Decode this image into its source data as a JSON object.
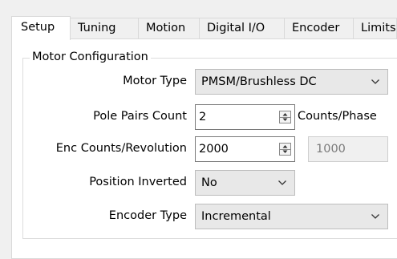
{
  "tabs": [
    {
      "label": "Setup"
    },
    {
      "label": "Tuning"
    },
    {
      "label": "Motion"
    },
    {
      "label": "Digital I/O"
    },
    {
      "label": "Encoder"
    },
    {
      "label": "Limits"
    }
  ],
  "group": {
    "title": "Motor Configuration"
  },
  "fields": {
    "motor_type": {
      "label": "Motor Type",
      "value": "PMSM/Brushless DC"
    },
    "pole_pairs": {
      "label": "Pole Pairs Count",
      "value": "2",
      "unit": "Counts/Phase"
    },
    "enc_counts": {
      "label": "Enc Counts/Revolution",
      "value": "2000",
      "readonly_value": "1000"
    },
    "position_inverted": {
      "label": "Position Inverted",
      "value": "No"
    },
    "encoder_type": {
      "label": "Encoder Type",
      "value": "Incremental"
    }
  },
  "icons": {
    "dropdown": "chevron-down-icon",
    "spin": "spin-arrows-icon"
  }
}
